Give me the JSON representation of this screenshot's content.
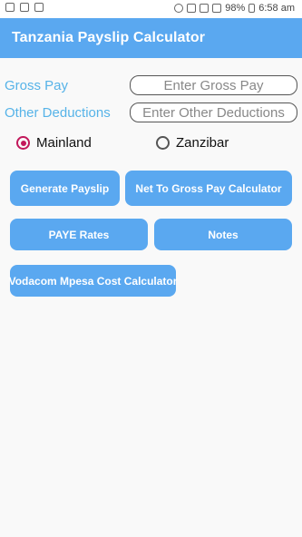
{
  "status_bar": {
    "battery_percent": "98%",
    "time": "6:58 am"
  },
  "app_bar": {
    "title": "Tanzania Payslip Calculator"
  },
  "form": {
    "gross_pay_label": "Gross Pay",
    "gross_pay_placeholder": "Enter Gross Pay",
    "gross_pay_value": "",
    "other_deductions_label": "Other Deductions",
    "other_deductions_placeholder": "Enter Other Deductions",
    "other_deductions_value": ""
  },
  "region": {
    "options": [
      {
        "label": "Mainland",
        "selected": true
      },
      {
        "label": "Zanzibar",
        "selected": false
      }
    ]
  },
  "buttons": {
    "generate_payslip": "Generate Payslip",
    "net_to_gross": "Net To Gross Pay Calculator",
    "paye_rates": "PAYE Rates",
    "notes": "Notes",
    "mpesa_calculator": "Vodacom Mpesa Cost Calculator"
  },
  "colors": {
    "accent": "#5aa8f0",
    "label": "#56b3e8",
    "radio_selected": "#c2185b"
  }
}
